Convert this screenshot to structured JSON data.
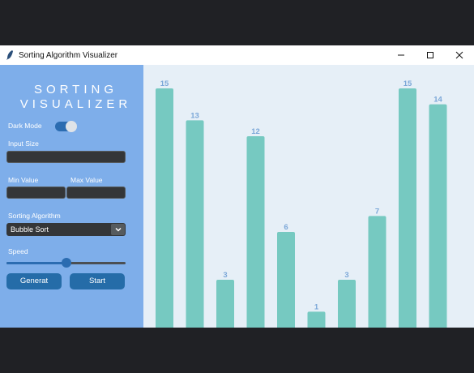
{
  "window": {
    "title": "Sorting Algorithm Visualizer",
    "icon": "feather-icon",
    "controls": [
      "minimize-icon",
      "maximize-icon",
      "close-icon"
    ]
  },
  "sidebar": {
    "logo_line1": "SORTING",
    "logo_line2": "VISUALIZER",
    "dark_mode_label": "Dark Mode",
    "dark_mode_on": true,
    "input_size_label": "Input Size",
    "input_size_value": "",
    "min_value_label": "Min Value",
    "min_value_value": "",
    "max_value_label": "Max Value",
    "max_value_value": "",
    "algorithm_label": "Sorting Algorithm",
    "algorithm_value": "Bubble Sort",
    "speed_label": "Speed",
    "speed_fraction": 0.5,
    "generate_label": "Generat",
    "start_label": "Start"
  },
  "colors": {
    "sidebar_bg": "#7eaeea",
    "canvas_bg": "#e6eff7",
    "bar": "#76c9c1",
    "bar_label": "#7ba7d8",
    "accent": "#2b6cb1"
  },
  "chart_data": {
    "type": "bar",
    "values": [
      15,
      13,
      3,
      12,
      6,
      1,
      3,
      7,
      15,
      14
    ]
  }
}
